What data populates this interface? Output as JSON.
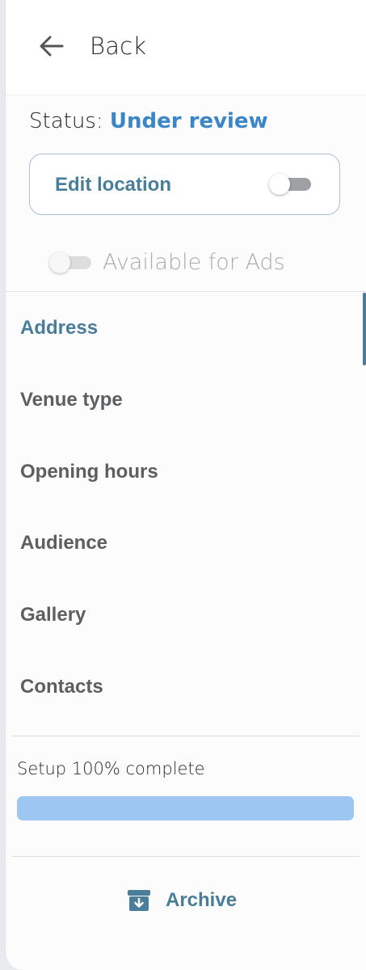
{
  "header": {
    "back_label": "Back",
    "back_icon": "arrow-left-icon"
  },
  "status": {
    "label": "Status:",
    "value": "Under review"
  },
  "edit_location": {
    "label": "Edit location",
    "toggle_on": false
  },
  "ads": {
    "label": "Available for Ads",
    "toggle_on": false,
    "disabled": true
  },
  "nav": {
    "items": [
      {
        "label": "Address",
        "active": true
      },
      {
        "label": "Venue type",
        "active": false
      },
      {
        "label": "Opening hours",
        "active": false
      },
      {
        "label": "Audience",
        "active": false
      },
      {
        "label": "Gallery",
        "active": false
      },
      {
        "label": "Contacts",
        "active": false
      }
    ]
  },
  "setup": {
    "text": "Setup 100% complete",
    "percent": 100
  },
  "archive": {
    "label": "Archive",
    "icon": "archive-box-icon"
  },
  "colors": {
    "accent": "#4a7d99",
    "status_blue": "#3a86c8",
    "progress": "#9dc6f2"
  }
}
